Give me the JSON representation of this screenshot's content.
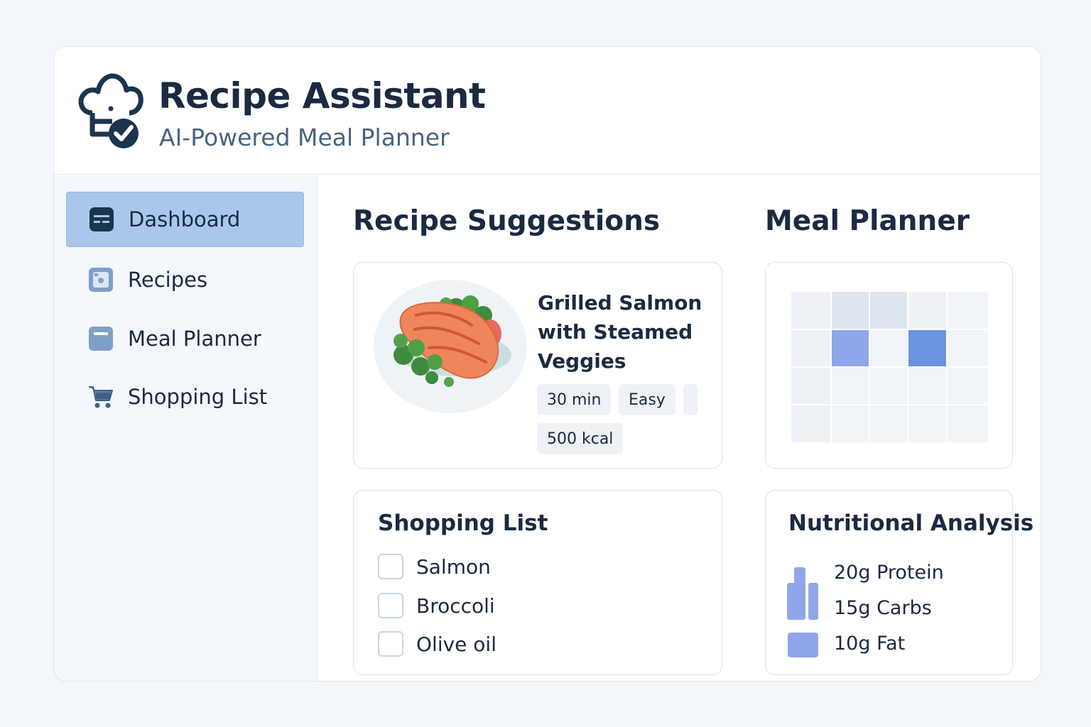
{
  "app": {
    "title": "Recipe Assistant",
    "subtitle": "AI-Powered Meal Planner",
    "logo_icon": "chef-hat-check-icon"
  },
  "sidebar": {
    "items": [
      {
        "label": "Dashboard",
        "icon": "dashboard-icon",
        "active": true
      },
      {
        "label": "Recipes",
        "icon": "recipe-book-icon",
        "active": false
      },
      {
        "label": "Meal Planner",
        "icon": "calendar-icon",
        "active": false
      },
      {
        "label": "Shopping List",
        "icon": "cart-icon",
        "active": false
      }
    ]
  },
  "main": {
    "recipe_suggestions_title": "Recipe Suggestions",
    "meal_planner_title": "Meal Planner",
    "recipe": {
      "name": "Grilled Salmon with Steamed Veggies",
      "tags": [
        "30 min",
        "Easy",
        "",
        "500 kcal"
      ]
    },
    "shopping_list": {
      "title": "Shopping List",
      "items": [
        "Salmon",
        "Broccoli",
        "Olive oil"
      ]
    },
    "nutrition": {
      "title": "Nutritional Analysis",
      "items": [
        "20g Protein",
        "15g Carbs",
        "10g Fat"
      ]
    }
  },
  "colors": {
    "accent_active": "#a8c7ea",
    "primary_text": "#1b2a41",
    "planner_cell_light": "#8fa6ea",
    "planner_cell_dark": "#6c93e0",
    "nutrition_bar": "#8fa6ea"
  }
}
